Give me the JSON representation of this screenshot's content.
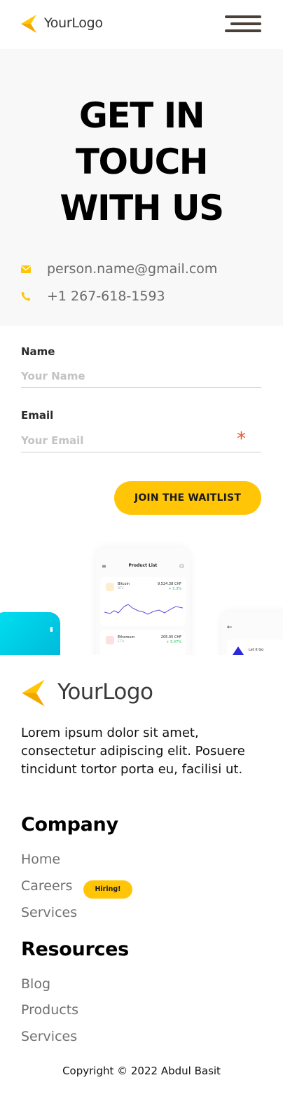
{
  "header": {
    "logo_text": "YourLogo",
    "menu_icon": "hamburger-menu-icon"
  },
  "hero": {
    "title_lines": [
      "GET IN",
      "TOUCH",
      "WITH US"
    ],
    "email": "person.name@gmail.com",
    "phone": "+1 267-618-1593",
    "email_icon": "envelope-icon",
    "phone_icon": "phone-icon"
  },
  "form": {
    "name_label": "Name",
    "name_placeholder": "Your Name",
    "email_label": "Email",
    "email_placeholder": "Your Email",
    "required_mark": "*",
    "submit_label": "JOIN THE WAITLIST"
  },
  "mockup": {
    "screen_title": "Product List",
    "cards": [
      {
        "name": "Bitcoin",
        "symbol": "BTC",
        "price": "9,524.38 CHF",
        "change": "+ 5.3%"
      },
      {
        "name": "Ethereum",
        "symbol": "ETH",
        "price": "205.05 CHF",
        "change": "+ 5.47%"
      }
    ],
    "right_card_label": "Let it Go"
  },
  "footer": {
    "logo_text": "YourLogo",
    "about": "Lorem ipsum dolor sit amet, consectetur adipiscing elit. Posuere tincidunt tortor porta eu, facilisi ut.",
    "company_title": "Company",
    "company_links": [
      "Home",
      "Careers",
      "Services"
    ],
    "hiring_badge": "Hiring!",
    "resources_title": "Resources",
    "resources_links": [
      "Blog",
      "Products",
      "Services"
    ],
    "copyright": "Copyright © 2022 Abdul Basit"
  },
  "colors": {
    "accent": "#ffc506",
    "hero_bg": "#f8f8f8",
    "required": "#e8533a"
  }
}
